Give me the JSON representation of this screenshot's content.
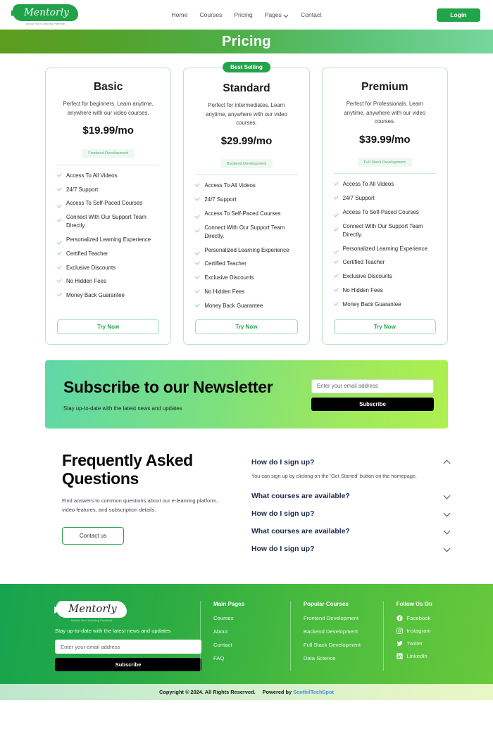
{
  "header": {
    "logo": {
      "name": "Mentorly",
      "tagline": "Unlock Your Learning Potential"
    },
    "nav": [
      {
        "label": "Home",
        "has_chevron": false
      },
      {
        "label": "Courses",
        "has_chevron": false
      },
      {
        "label": "Pricing",
        "has_chevron": false
      },
      {
        "label": "Pages",
        "has_chevron": true
      },
      {
        "label": "Contact",
        "has_chevron": false
      }
    ],
    "login_label": "Login"
  },
  "banner": {
    "title": "Pricing"
  },
  "pricing": {
    "best_selling_badge": "Best Selling",
    "cards": [
      {
        "title": "Basic",
        "description": "Perfect for beginners. Learn anytime, anywhere with our video courses.",
        "price": "$19.99/mo",
        "tag": "Frontend Development",
        "features": [
          "Access To All Videos",
          "24/7 Support",
          "Access To Self-Paced Courses",
          "Connect With Our Support Team Directly.",
          "Personalized Learning Experience",
          "Certified Teacher",
          "Exclusive Discounts",
          "No Hidden Fees",
          "Money Back Guarantee"
        ],
        "cta": "Try Now",
        "featured": false
      },
      {
        "title": "Standard",
        "description": "Perfect for intermediates. Learn anytime, anywhere with our video courses.",
        "price": "$29.99/mo",
        "tag": "Backend Development",
        "features": [
          "Access To All Videos",
          "24/7 Support",
          "Access To Self-Paced Courses",
          "Connect With Our Support Team Directly.",
          "Personalized Learning Experience",
          "Certified Teacher",
          "Exclusive Discounts",
          "No Hidden Fees",
          "Money Back Guarantee"
        ],
        "cta": "Try Now",
        "featured": true
      },
      {
        "title": "Premium",
        "description": "Perfect for Professionals. Learn anytime, anywhere with our video courses.",
        "price": "$39.99/mo",
        "tag": "Full Stack Development",
        "features": [
          "Access To All Videos",
          "24/7 Support",
          "Access To Self-Paced Courses",
          "Connect With Our Support Team Directly.",
          "Personalized Learning Experience",
          "Certified Teacher",
          "Exclusive Discounts",
          "No Hidden Fees",
          "Money Back Guarantee"
        ],
        "cta": "Try Now",
        "featured": false
      }
    ]
  },
  "newsletter": {
    "title": "Subscribe to our Newsletter",
    "subtitle": "Stay up-to-date with the latest news and updates",
    "input_placeholder": "Enter your email address",
    "input_value": "",
    "button_label": "Subscribe"
  },
  "faq": {
    "heading": "Frequently Asked Questions",
    "subtitle": "Find answers to common questions about our e-learning platform, video features, and subscription details.",
    "contact_label": "Contact us",
    "items": [
      {
        "question": "How do I sign up?",
        "answer": "You can sign up by clicking on the 'Get Started' button on the homepage.",
        "expanded": true
      },
      {
        "question": "What courses are available?",
        "answer": "",
        "expanded": false
      },
      {
        "question": "How do I sign up?",
        "answer": "",
        "expanded": false
      },
      {
        "question": "What courses are available?",
        "answer": "",
        "expanded": false
      },
      {
        "question": "How do I sign up?",
        "answer": "",
        "expanded": false
      }
    ]
  },
  "footer": {
    "logo": {
      "name": "Mentorly",
      "tagline": "Unlock Your Learning Potential"
    },
    "subtitle": "Stay up-to-date with the latest news and updates",
    "input_placeholder": "Enter your email address",
    "input_value": "",
    "button_label": "Subscribe",
    "columns": [
      {
        "title": "Main Pages",
        "links": [
          "Courses",
          "About",
          "Contact",
          "FAQ"
        ]
      },
      {
        "title": "Popular Courses",
        "links": [
          "Frontend Development",
          "Backend Development",
          "Full Stack Development",
          "Data Science"
        ]
      }
    ],
    "social": {
      "title": "Follow Us On",
      "items": [
        {
          "label": "Facebook",
          "icon": "facebook-icon"
        },
        {
          "label": "Instagram",
          "icon": "instagram-icon"
        },
        {
          "label": "Twitter",
          "icon": "twitter-icon"
        },
        {
          "label": "LinkedIn",
          "icon": "linkedin-icon"
        }
      ]
    }
  },
  "copyright": {
    "text": "Copyright © 2024. All Rights Reserved.",
    "powered_prefix": "Powered by",
    "powered_brand": "SenthilTechSpot"
  },
  "colors": {
    "brand_green": "#22a44b",
    "banner_gradient_start": "#5d9c1e",
    "banner_gradient_end": "#76d79c",
    "newsletter_gradient_start": "#5fd8a8",
    "newsletter_gradient_end": "#aef04e",
    "faq_heading": "#1e2a4a",
    "powered_link": "#4a8fdd",
    "check_green": "#8fd3a8"
  }
}
